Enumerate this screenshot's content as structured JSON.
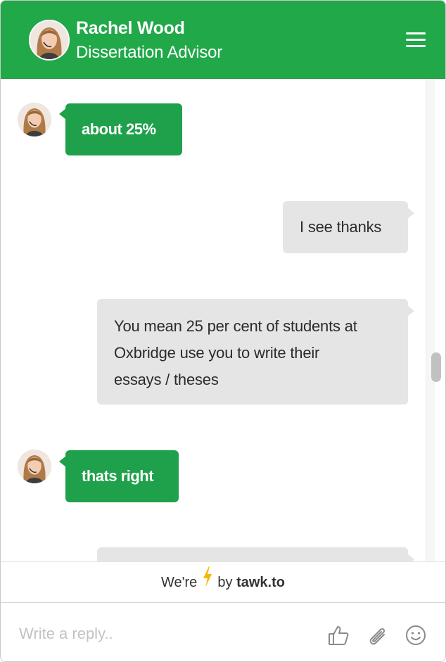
{
  "header": {
    "agent_name": "Rachel Wood",
    "agent_title": "Dissertation Advisor",
    "menu_icon": "hamburger-menu-icon"
  },
  "messages": [
    {
      "sender": "agent",
      "text": "about 25%"
    },
    {
      "sender": "visitor",
      "text": "I see thanks"
    },
    {
      "sender": "visitor",
      "lines": [
        "You mean 25 per cent of students at",
        "Oxbridge use you to write their",
        "essays / theses"
      ]
    },
    {
      "sender": "agent",
      "text": "thats right"
    },
    {
      "sender": "visitor",
      "text": ""
    }
  ],
  "footer": {
    "powered_prefix": "We're",
    "powered_suffix": "by",
    "brand": "tawk.to",
    "bolt_icon": "lightning-bolt-icon",
    "bolt_color": "#f5b800"
  },
  "compose": {
    "placeholder": "Write a reply..",
    "icons": [
      "thumbs-up-icon",
      "paperclip-icon",
      "smiley-icon"
    ]
  },
  "colors": {
    "header_bg": "#20a849",
    "agent_bubble": "#1fa04a",
    "visitor_bubble": "#e5e5e5"
  }
}
